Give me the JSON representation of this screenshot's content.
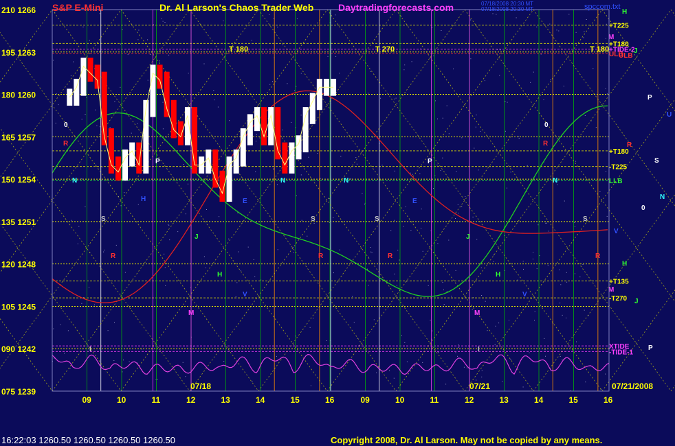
{
  "header": {
    "symbol": "S&P E-Mini",
    "title": "Dr. Al Larson's Chaos Trader Web",
    "site": "Daytradingforecasts.com",
    "timestamp_line1": "07/18/2008 20:30 MT",
    "timestamp_line2": "07/18/2008 20:30 MT",
    "file": "spccom.txt"
  },
  "footer": {
    "quote_line": "16:22:03  1260.50  1260.50  1260.50  1260.50",
    "copyright": "Copyright 2008, Dr. Al Larson. May not be copied by any means."
  },
  "colors": {
    "background": "#0b0b5a",
    "price_up": "#ffffff",
    "price_down": "#ff0000",
    "grid_yellow": "#e6e600",
    "grid_green": "#00c000",
    "grid_magenta": "#ff40ff",
    "tide_green": "#20d020",
    "tide_red": "#e02020",
    "oscillator": "#e040e0"
  },
  "chart_data": {
    "type": "line",
    "title": "S&P E-Mini",
    "y_axis_left": {
      "tick_labels": [
        "210 1266",
        "195 1263",
        "180 1260",
        "165 1257",
        "150 1254",
        "135 1251",
        "120 1248",
        "105 1245",
        "090 1242",
        "075 1239"
      ],
      "price_range": [
        1239,
        1266
      ]
    },
    "x_axis": {
      "tick_labels": [
        "09",
        "10",
        "11",
        "12",
        "13",
        "14",
        "15",
        "16",
        "09",
        "10",
        "11",
        "12",
        "13",
        "14",
        "15",
        "16"
      ],
      "date_labels": [
        "07/18",
        "07/21",
        "07/21/2008"
      ]
    },
    "price_bars": {
      "date": "07/18",
      "hour": [
        8.5,
        8.7,
        8.9,
        9.1,
        9.3,
        9.5,
        9.7,
        9.9,
        10.1,
        10.3,
        10.5,
        10.7,
        10.9,
        11.1,
        11.3,
        11.5,
        11.7,
        11.9,
        12.1,
        12.3,
        12.5,
        12.7,
        12.9,
        13.1,
        13.3,
        13.5,
        13.7,
        13.9,
        14.1,
        14.3,
        14.5,
        14.7,
        14.9,
        15.1,
        15.3,
        15.5,
        15.7,
        15.9,
        16.1
      ],
      "price": [
        1259.8,
        1260.5,
        1262.0,
        1261.5,
        1261.0,
        1257.0,
        1255.0,
        1254.5,
        1255.5,
        1256.0,
        1255.0,
        1259.0,
        1261.5,
        1261.0,
        1259.0,
        1257.5,
        1257.0,
        1258.5,
        1255.0,
        1255.0,
        1255.5,
        1254.0,
        1253.0,
        1255.0,
        1255.5,
        1257.0,
        1258.0,
        1258.5,
        1257.0,
        1258.5,
        1256.0,
        1255.0,
        1256.0,
        1256.5,
        1258.5,
        1259.5,
        1260.5,
        1260.5,
        1260.5
      ]
    },
    "levels": [
      {
        "label": "+T225",
        "price": 1264.9
      },
      {
        "label": "+T180",
        "price": 1263.6
      },
      {
        "label": "+TIDE-2",
        "price": 1263.2
      },
      {
        "label": "ULB",
        "price": 1262.9
      },
      {
        "label": "+T180",
        "price": 1256.0
      },
      {
        "label": "-T225",
        "price": 1254.9
      },
      {
        "label": "LLB",
        "price": 1253.9
      },
      {
        "label": "+T135",
        "price": 1246.8
      },
      {
        "label": "-T270",
        "price": 1245.6
      },
      {
        "label": "XTIDE",
        "price": 1242.2
      },
      {
        "label": "-TIDE-1",
        "price": 1241.8
      }
    ],
    "level_labels_in_chart": [
      "T 180",
      "T 270",
      "T 180"
    ],
    "right_markers": [
      "H",
      "M",
      "ULB",
      "R",
      "J",
      "P",
      "U",
      "S",
      "N",
      "0",
      "V",
      "H",
      "M",
      "J",
      "P"
    ],
    "chart_markers": [
      "0",
      "0",
      "R",
      "R",
      "P",
      "P",
      "N",
      "N",
      "N",
      "N",
      "S",
      "S",
      "S",
      "S",
      "R",
      "R",
      "R",
      "R",
      "M",
      "M",
      "H",
      "H",
      "H",
      "V",
      "V",
      "J",
      "J",
      "E",
      "E",
      "I",
      "I"
    ]
  }
}
